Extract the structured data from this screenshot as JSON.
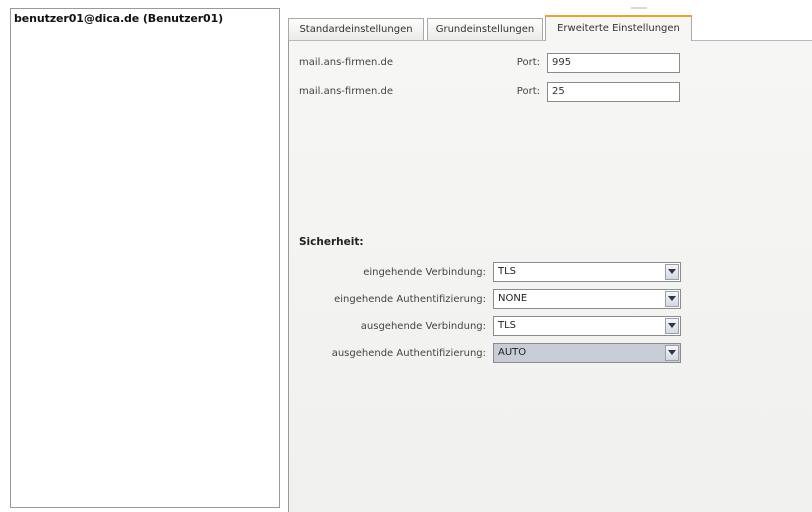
{
  "account": {
    "entry": "benutzer01@dica.de (Benutzer01)"
  },
  "tabs": [
    {
      "label": "Standardeinstellungen",
      "active": false
    },
    {
      "label": "Grundeinstellungen",
      "active": false
    },
    {
      "label": "Erweiterte Einstellungen",
      "active": true
    }
  ],
  "servers": [
    {
      "host": "mail.ans-firmen.de",
      "port_label": "Port:",
      "port": "995"
    },
    {
      "host": "mail.ans-firmen.de",
      "port_label": "Port:",
      "port": "25"
    }
  ],
  "security": {
    "heading": "Sicherheit:",
    "rows": [
      {
        "label": "eingehende Verbindung:",
        "value": "TLS"
      },
      {
        "label": "eingehende Authentifizierung:",
        "value": "NONE"
      },
      {
        "label": "ausgehende Verbindung:",
        "value": "TLS"
      },
      {
        "label": "ausgehende Authentifizierung:",
        "value": "AUTO"
      }
    ]
  },
  "icons": {
    "dropdown": "chevron-down-icon"
  }
}
